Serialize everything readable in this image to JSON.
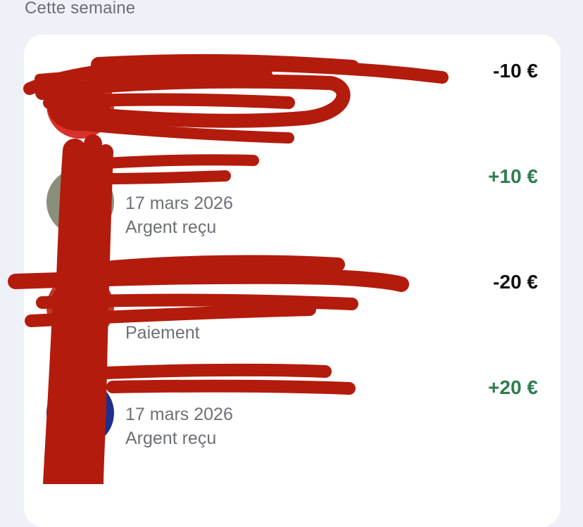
{
  "section": {
    "title": "Cette semaine"
  },
  "transactions": [
    {
      "name": "",
      "date": "",
      "type": "",
      "amount": "-10 €",
      "direction": "out",
      "avatar_color": "#d7312b"
    },
    {
      "name": "",
      "date": "17 mars 2026",
      "type": "Argent reçu",
      "amount": "+10 €",
      "direction": "in",
      "avatar_color": "#8a8f7a"
    },
    {
      "name": "",
      "date": "",
      "type": "Paiement",
      "amount": "-20 €",
      "direction": "out",
      "avatar_color": "#c03a2b"
    },
    {
      "name": "",
      "date": "17 mars 2026",
      "type": "Argent reçu",
      "amount": "+20 €",
      "direction": "in",
      "avatar_color": "#1e2f8c"
    }
  ],
  "colors": {
    "background": "#eef1f8",
    "card": "#ffffff",
    "positive_amount": "#2f7d4f",
    "negative_amount": "#111111",
    "secondary_text": "#6d7077",
    "redaction": "#b31b0c"
  }
}
